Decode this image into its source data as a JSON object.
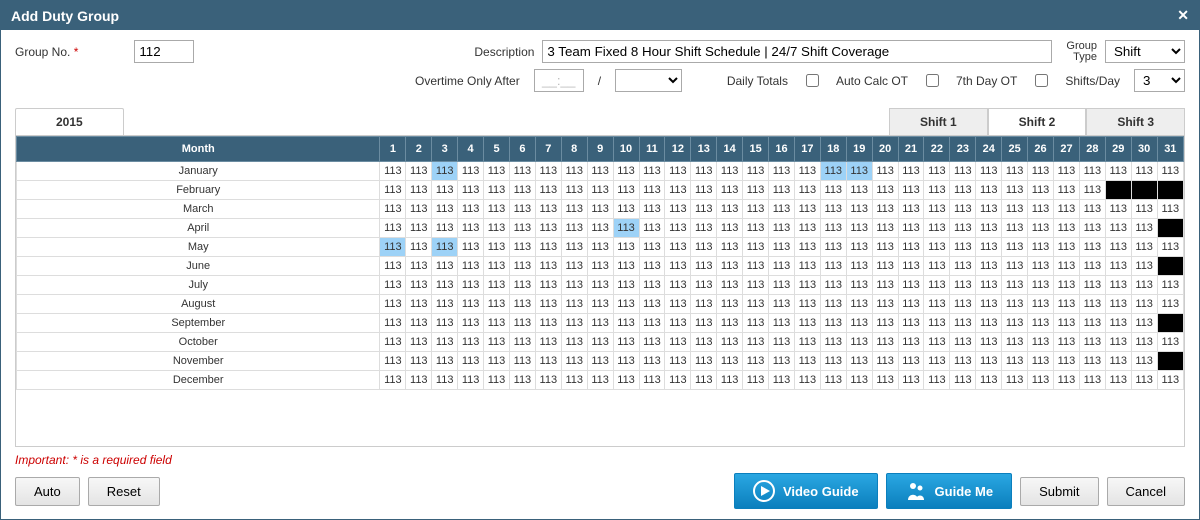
{
  "title": "Add Duty Group",
  "form": {
    "group_no_label": "Group No.",
    "group_no_value": "112",
    "description_label": "Description",
    "description_value": "3 Team Fixed 8 Hour Shift Schedule | 24/7 Shift Coverage",
    "group_type_label_top": "Group",
    "group_type_label_bot": "Type",
    "group_type_value": "Shift",
    "overtime_only_after_label": "Overtime Only After",
    "overtime_only_after_value": "__:__",
    "slash": "/",
    "daily_totals_label": "Daily Totals",
    "auto_calc_ot_label": "Auto Calc OT",
    "seventh_day_ot_label": "7th Day OT",
    "shifts_per_day_label": "Shifts/Day",
    "shifts_per_day_value": "3"
  },
  "year_tab": "2015",
  "shift_tabs": [
    "Shift 1",
    "Shift 2",
    "Shift 3"
  ],
  "shift_tab_active": 1,
  "grid": {
    "month_header": "Month",
    "months": [
      "January",
      "February",
      "March",
      "April",
      "May",
      "June",
      "July",
      "August",
      "September",
      "October",
      "November",
      "December"
    ],
    "month_days": [
      31,
      28,
      31,
      30,
      31,
      30,
      31,
      31,
      30,
      31,
      30,
      31
    ],
    "cell_value": "113",
    "highlights": {
      "January": [
        3,
        18,
        19
      ],
      "April": [
        10
      ],
      "May": [
        1,
        3
      ]
    }
  },
  "footer": {
    "important": "Important: * is a required field",
    "auto": "Auto",
    "reset": "Reset",
    "video_guide": "Video Guide",
    "guide_me": "Guide Me",
    "submit": "Submit",
    "cancel": "Cancel"
  }
}
